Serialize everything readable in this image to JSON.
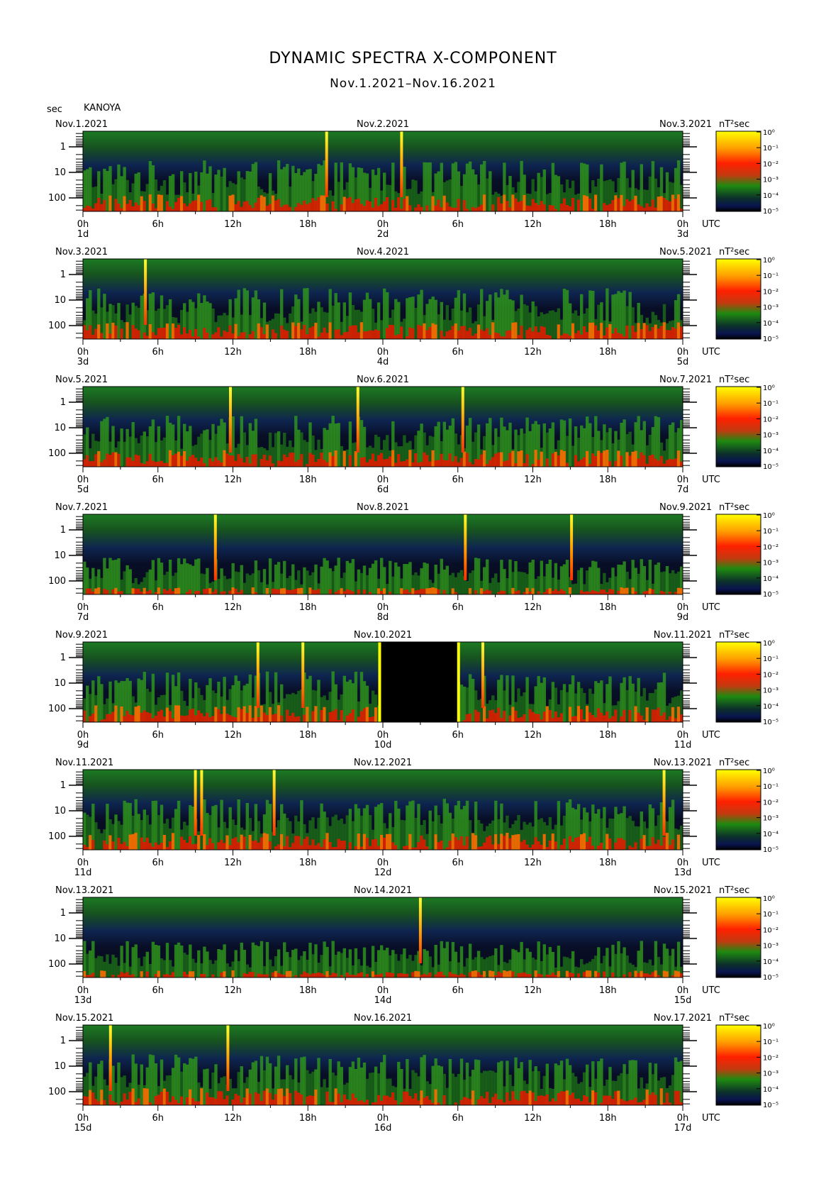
{
  "title": "DYNAMIC SPECTRA X-COMPONENT",
  "subtitle": "Nov.1.2021–Nov.16.2021",
  "station": "KANOYA",
  "y_unit": "sec",
  "colorbar_unit": "nT²sec",
  "x_unit": "UTC",
  "colorbar": {
    "labels": [
      "10⁰",
      "10⁻¹",
      "10⁻²",
      "10⁻³",
      "10⁻⁴",
      "10⁻⁵"
    ],
    "colors": [
      "#ffff00",
      "#ff9900",
      "#ff2200",
      "#1f8a10",
      "#0a1550",
      "#000000"
    ]
  },
  "chart_data": {
    "type": "heatmap",
    "y_axis": {
      "label": "sec",
      "ticks": [
        "1",
        "10",
        "100"
      ],
      "scale": "log"
    },
    "x_ticks": [
      "0h",
      "6h",
      "12h",
      "18h",
      "0h",
      "6h",
      "12h",
      "18h",
      "0h"
    ],
    "panels": [
      {
        "start_date": "Nov.1.2021",
        "mid_date": "Nov.2.2021",
        "end_date": "Nov.3.2021",
        "days": [
          "1d",
          "2d",
          "3d"
        ],
        "spikes_h": [
          19.5,
          25.5
        ],
        "gap": null
      },
      {
        "start_date": "Nov.3.2021",
        "mid_date": "Nov.4.2021",
        "end_date": "Nov.5.2021",
        "days": [
          "3d",
          "4d",
          "5d"
        ],
        "spikes_h": [
          5.0
        ],
        "gap": null
      },
      {
        "start_date": "Nov.5.2021",
        "mid_date": "Nov.6.2021",
        "end_date": "Nov.7.2021",
        "days": [
          "5d",
          "6d",
          "7d"
        ],
        "spikes_h": [
          11.8,
          22.0,
          30.4
        ],
        "gap": null
      },
      {
        "start_date": "Nov.7.2021",
        "mid_date": "Nov.8.2021",
        "end_date": "Nov.9.2021",
        "days": [
          "7d",
          "8d",
          "9d"
        ],
        "spikes_h": [
          10.6,
          30.6,
          39.1
        ],
        "gap": null
      },
      {
        "start_date": "Nov.9.2021",
        "mid_date": "Nov.10.2021",
        "end_date": "Nov.11.2021",
        "days": [
          "9d",
          "10d",
          "11d"
        ],
        "spikes_h": [
          14.0,
          17.6,
          32.0
        ],
        "gap": [
          23.8,
          30.0
        ]
      },
      {
        "start_date": "Nov.11.2021",
        "mid_date": "Nov.12.2021",
        "end_date": "Nov.13.2021",
        "days": [
          "11d",
          "12d",
          "13d"
        ],
        "spikes_h": [
          9.0,
          9.5,
          15.3,
          46.5
        ],
        "gap": null
      },
      {
        "start_date": "Nov.13.2021",
        "mid_date": "Nov.14.2021",
        "end_date": "Nov.15.2021",
        "days": [
          "13d",
          "14d",
          "15d"
        ],
        "spikes_h": [
          27.0
        ],
        "gap": null
      },
      {
        "start_date": "Nov.15.2021",
        "mid_date": "Nov.16.2021",
        "end_date": "Nov.17.2021",
        "days": [
          "15d",
          "16d",
          "17d"
        ],
        "spikes_h": [
          2.2,
          11.6
        ],
        "gap": null
      }
    ]
  }
}
